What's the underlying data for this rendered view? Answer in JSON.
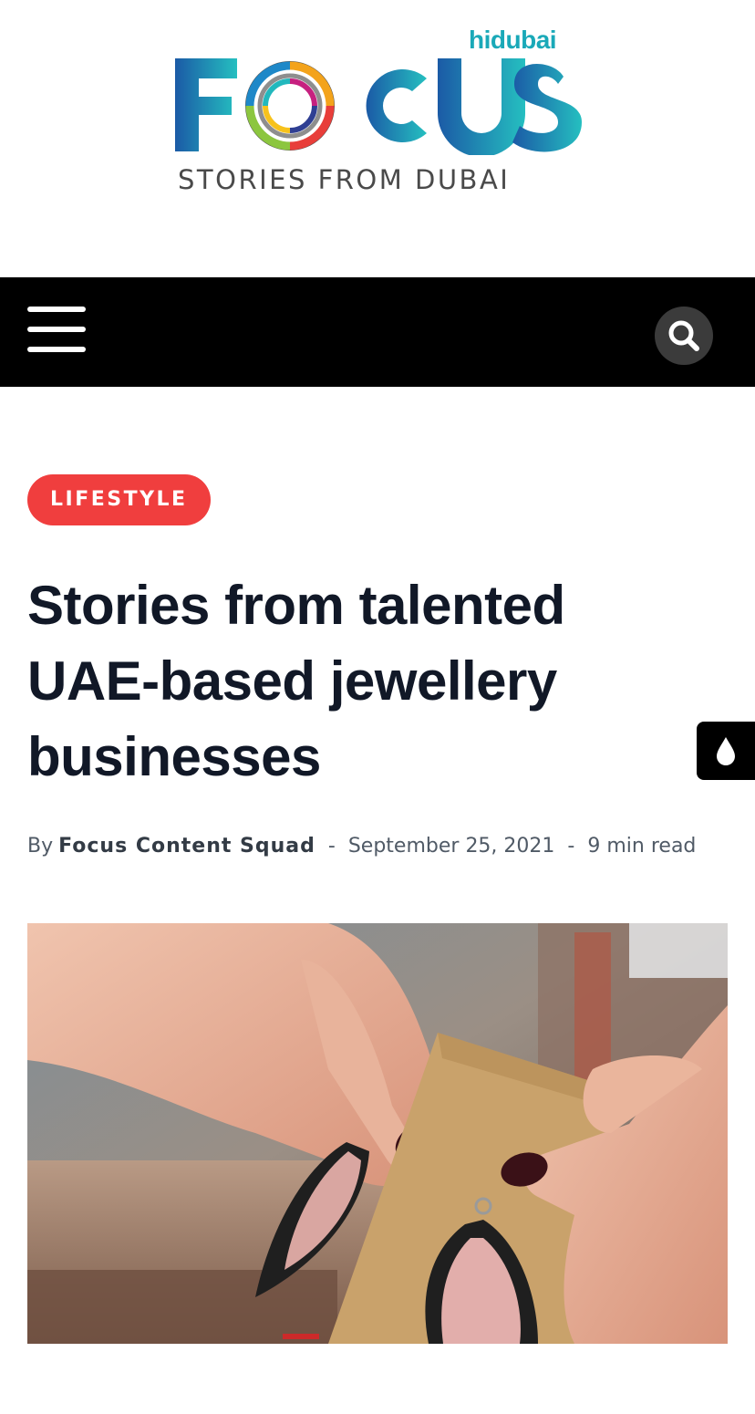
{
  "brand": {
    "tag": "hidubai",
    "word": "FOCUS",
    "tagline": "STORIES FROM DUBAI",
    "colors": {
      "blue": "#1b5aa6",
      "teal": "#22b8bd"
    }
  },
  "nav": {
    "menu_icon": "hamburger-menu-icon",
    "search_icon": "search-icon"
  },
  "article": {
    "category": "LIFESTYLE",
    "title": "Stories from talented UAE-based jewellery businesses",
    "by_label": "By",
    "author": "Focus Content Squad",
    "separator": "-",
    "date": "September 25, 2021",
    "read_time": "9 min read",
    "hero_image": "hands-holding-leather-earrings-photo"
  },
  "dark_mode_toggle": {
    "icon": "droplet-icon"
  },
  "accent_color": "#f03e3e"
}
